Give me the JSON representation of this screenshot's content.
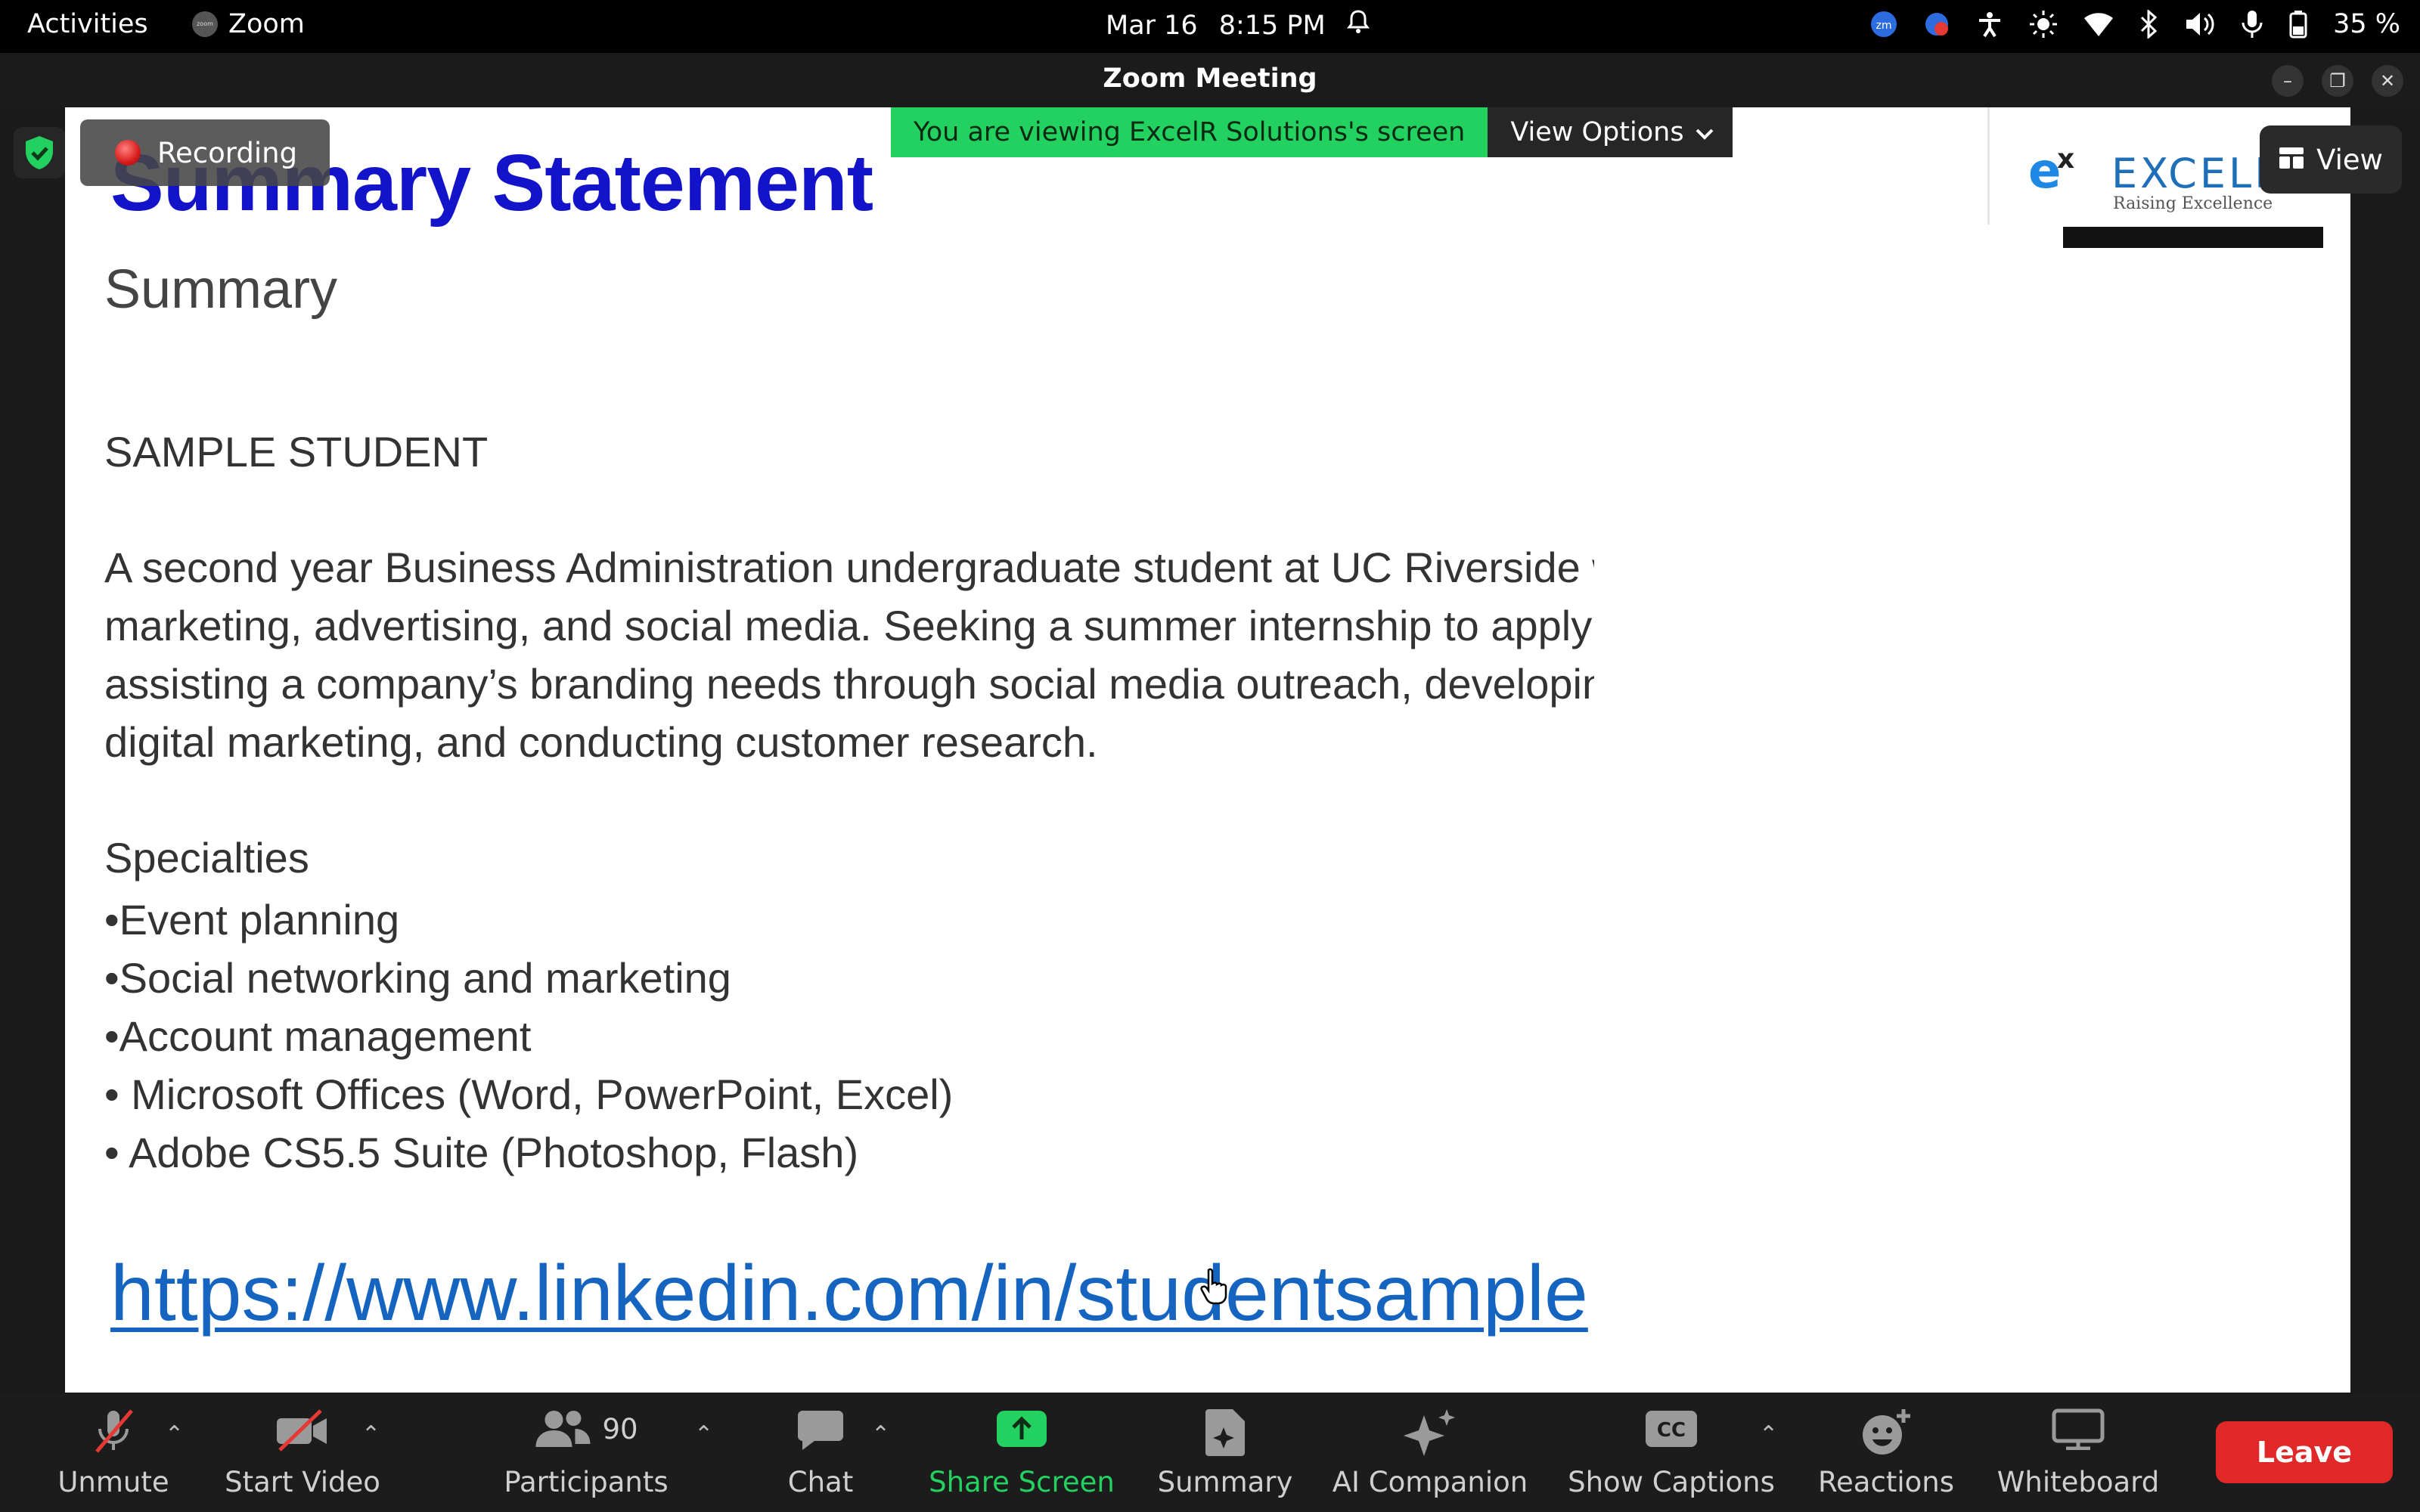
{
  "system_bar": {
    "activities": "Activities",
    "app_name": "Zoom",
    "app_icon_text": "zoom",
    "date": "Mar 16",
    "time": "8:15 PM",
    "battery": "35 %",
    "icons": [
      "zoom-tray-icon",
      "notifier-tray-icon",
      "accessibility-icon",
      "brightness-icon",
      "wifi-icon",
      "bluetooth-icon",
      "volume-icon",
      "microphone-icon",
      "battery-icon"
    ]
  },
  "window": {
    "title": "Zoom Meeting",
    "buttons": [
      "minimize",
      "restore",
      "close"
    ]
  },
  "meeting": {
    "recording_label": "Recording",
    "share_banner": "You are viewing ExcelR Solutions's screen",
    "view_options_label": "View Options",
    "view_label": "View"
  },
  "slide": {
    "title": "Summary Statement",
    "summary_heading": "Summary",
    "student_name": "SAMPLE STUDENT",
    "paragraph_lines": [
      "A second year Business Administration undergraduate student at UC Riverside with an interest in",
      "marketing, advertising, and social media. Seeking a summer internship to apply my experience",
      "assisting a company’s branding needs through social media outreach, developing marketing plans,",
      "digital marketing, and conducting customer research."
    ],
    "specialties_heading": "Specialties",
    "specialties": [
      "•Event planning",
      "•Social networking and marketing",
      "•Account management",
      "• Microsoft Offices (Word, PowerPoint, Excel)",
      "• Adobe CS5.5 Suite (Photoshop, Flash)"
    ],
    "link": "https://www.linkedin.com/in/studentsample",
    "logo_text": "EXCELR",
    "logo_tagline": "Raising Excellence"
  },
  "toolbar": {
    "unmute": "Unmute",
    "start_video": "Start Video",
    "participants": "Participants",
    "participants_count": "90",
    "chat": "Chat",
    "share_screen": "Share Screen",
    "summary": "Summary",
    "ai_companion": "AI Companion",
    "show_captions": "Show Captions",
    "captions_icon_text": "CC",
    "reactions": "Reactions",
    "whiteboard": "Whiteboard",
    "leave": "Leave"
  },
  "colors": {
    "slide_title": "#1313c9",
    "link": "#1565c0",
    "share_banner": "#23d160",
    "share_label": "#23d160",
    "leave": "#e02828"
  }
}
